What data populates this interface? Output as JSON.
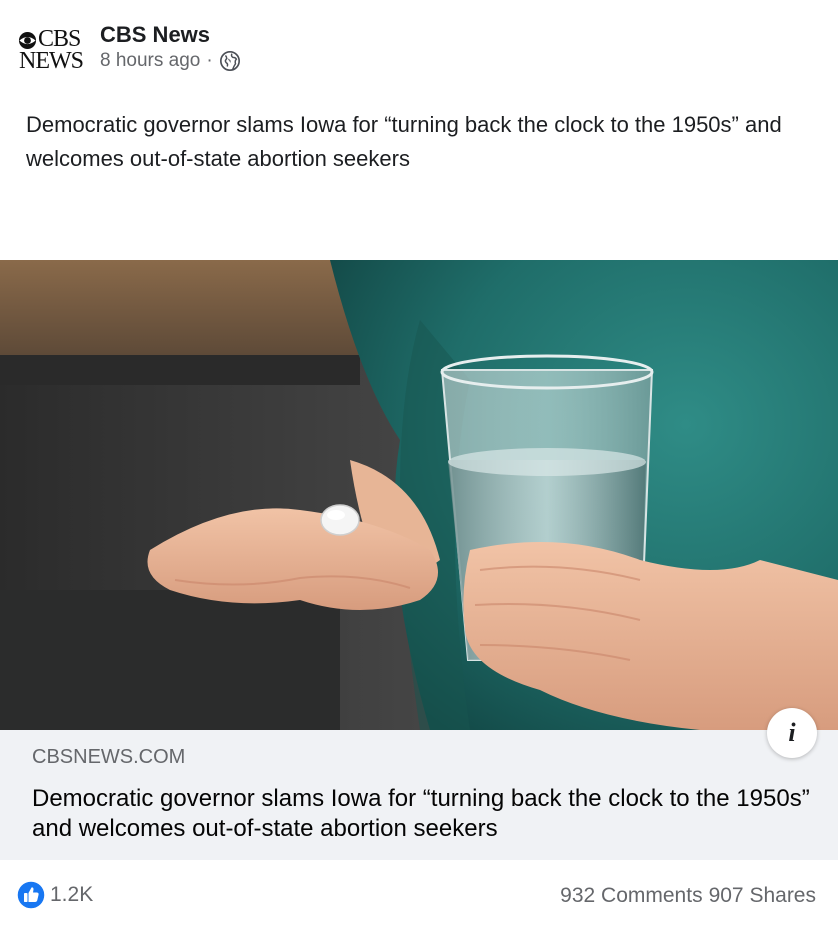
{
  "post": {
    "page_name": "CBS News",
    "logo": {
      "line1": "CBS",
      "line2": "NEWS"
    },
    "timestamp": "8 hours ago",
    "separator": "·",
    "privacy_icon": "globe-icon",
    "text": "Democratic governor slams Iowa for “turning back the clock to the 1950s” and welcomes out-of-state abortion seekers"
  },
  "photo": {
    "info_label": "i"
  },
  "link_preview": {
    "domain": "CBSNEWS.COM",
    "title": "Democratic governor slams Iowa for “turning back the clock to the 1950s” and welcomes out-of-state abortion seekers"
  },
  "footer": {
    "reaction_icon": "like-icon",
    "reaction_count": "1.2K",
    "comments": "932 Comments",
    "shares": "907 Shares"
  },
  "colors": {
    "like_blue": "#1877f2",
    "preview_bg": "#f0f2f5",
    "secondary_text": "#65676b"
  }
}
